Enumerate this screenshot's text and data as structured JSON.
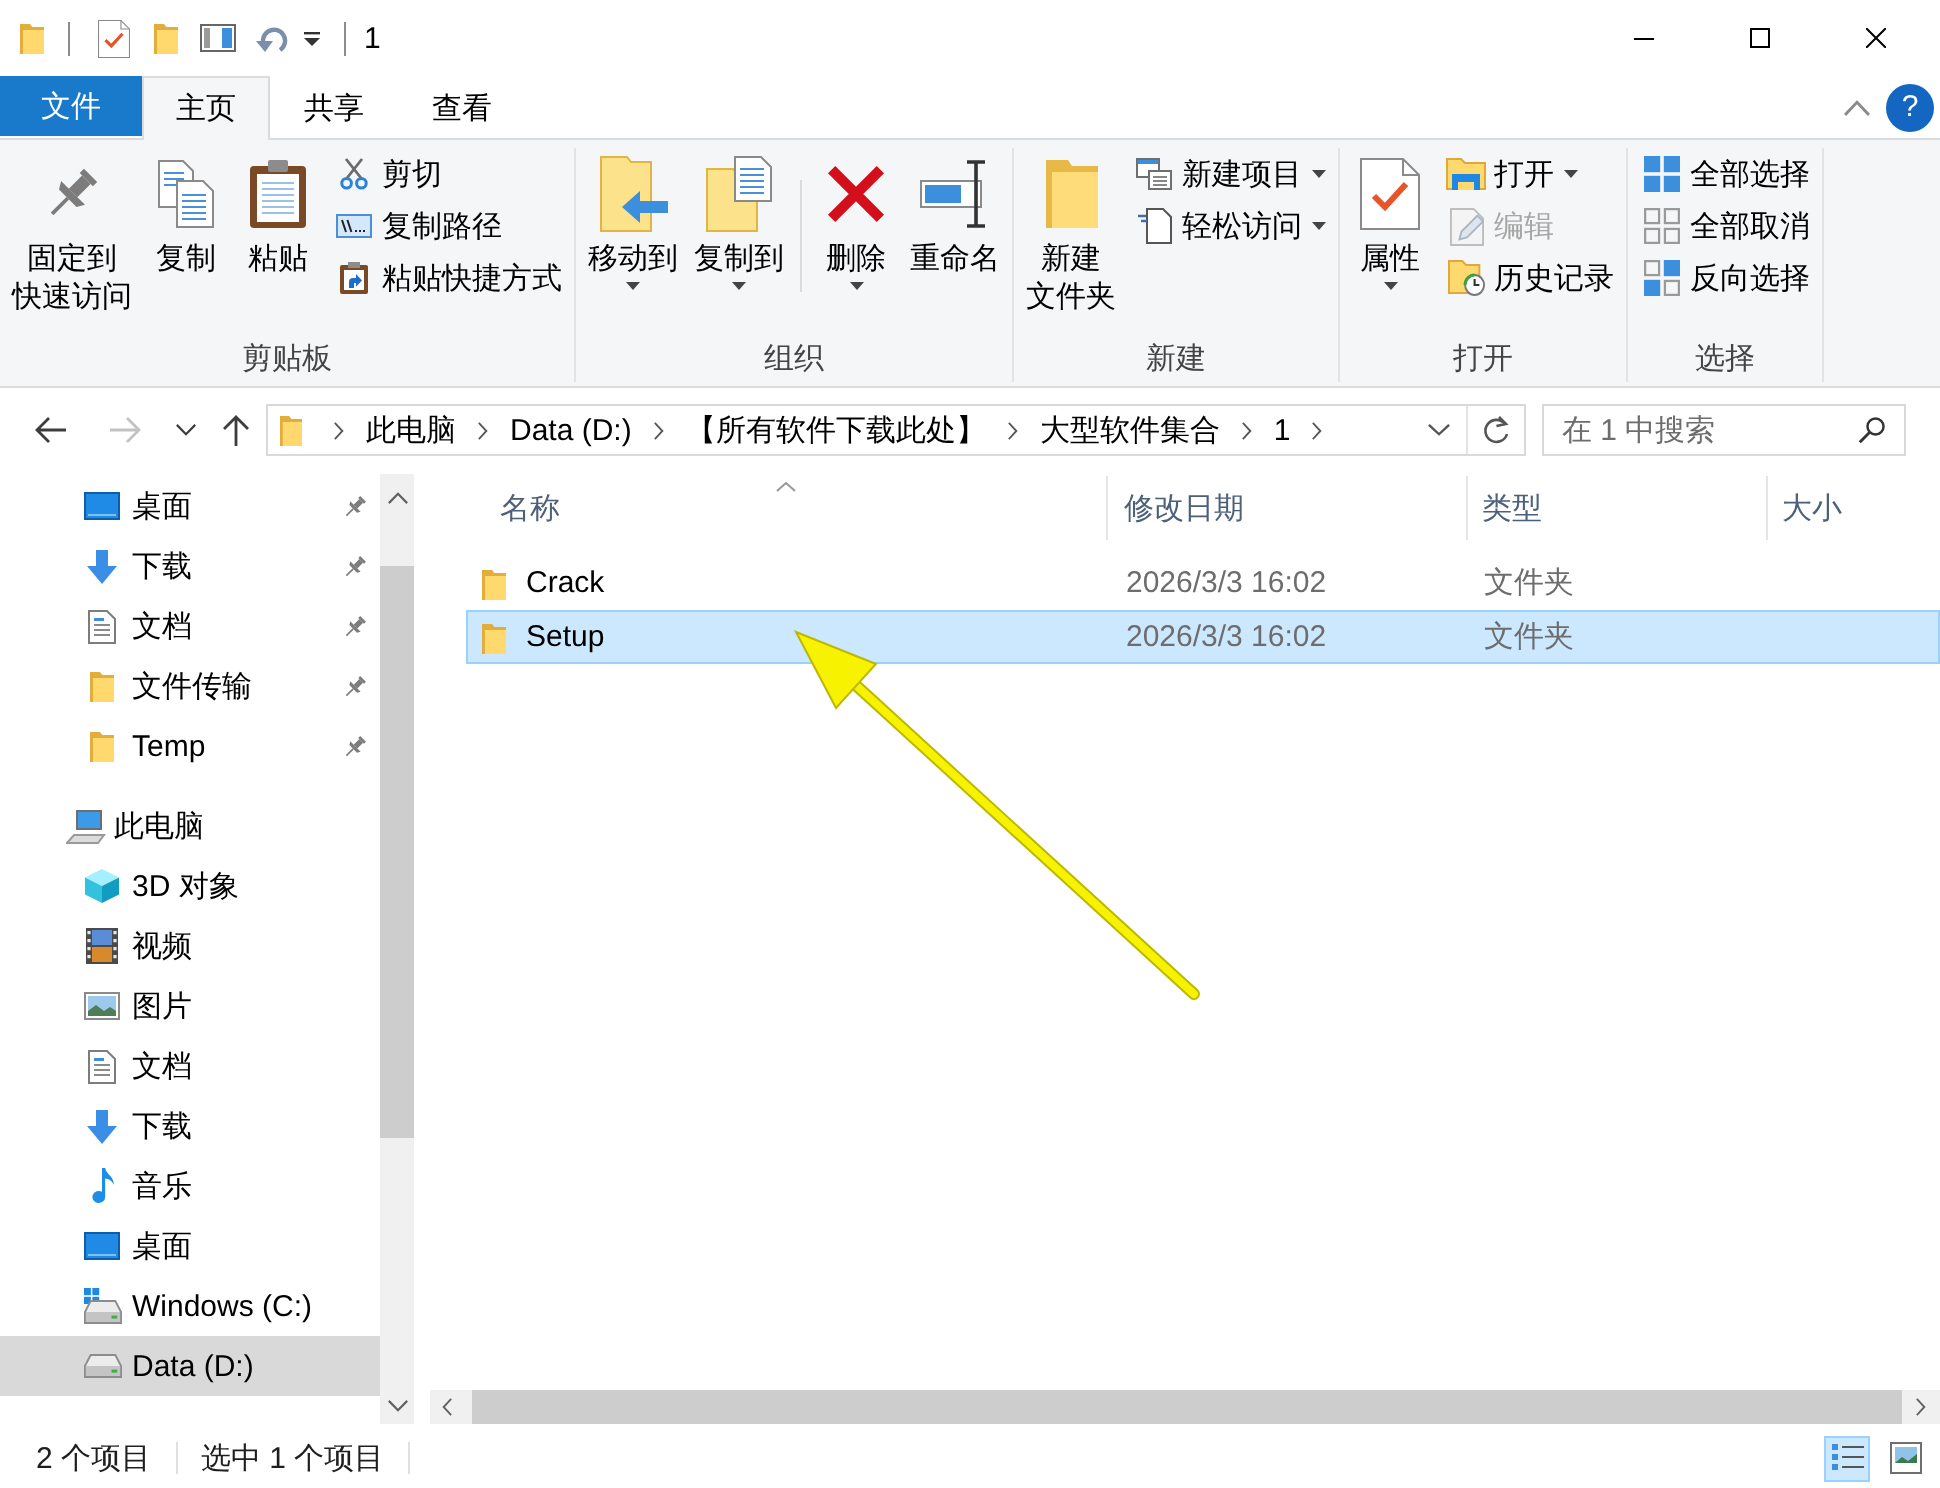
{
  "window": {
    "title": "1",
    "help_button": "?"
  },
  "tabs": [
    {
      "label": "文件",
      "kind": "file",
      "selected": false
    },
    {
      "label": "主页",
      "kind": "tab",
      "selected": true
    },
    {
      "label": "共享",
      "kind": "tab",
      "selected": false
    },
    {
      "label": "查看",
      "kind": "tab",
      "selected": false
    }
  ],
  "ribbon": {
    "groups": [
      {
        "label": "剪贴板",
        "columns": [
          {
            "kind": "large",
            "lines": [
              "固定到",
              "快速访问"
            ],
            "dropdown": false,
            "disabled": false
          },
          {
            "kind": "large",
            "lines": [
              "复制"
            ],
            "dropdown": false,
            "disabled": false
          },
          {
            "kind": "large",
            "lines": [
              "粘贴"
            ],
            "dropdown": false,
            "disabled": false
          },
          {
            "kind": "stack",
            "items": [
              {
                "label": "剪切",
                "dropdown": false,
                "disabled": false
              },
              {
                "label": "复制路径",
                "dropdown": false,
                "disabled": false
              },
              {
                "label": "粘贴快捷方式",
                "dropdown": false,
                "disabled": false
              }
            ]
          }
        ]
      },
      {
        "label": "组织",
        "columns": [
          {
            "kind": "large",
            "lines": [
              "移动到"
            ],
            "dropdown": true,
            "disabled": false
          },
          {
            "kind": "large",
            "lines": [
              "复制到"
            ],
            "dropdown": true,
            "disabled": false
          },
          {
            "kind": "separator"
          },
          {
            "kind": "large",
            "lines": [
              "删除"
            ],
            "dropdown": true,
            "disabled": false
          },
          {
            "kind": "large",
            "lines": [
              "重命名"
            ],
            "dropdown": false,
            "disabled": false
          }
        ]
      },
      {
        "label": "新建",
        "columns": [
          {
            "kind": "large",
            "lines": [
              "新建",
              "文件夹"
            ],
            "dropdown": false,
            "disabled": false
          },
          {
            "kind": "stack",
            "items": [
              {
                "label": "新建项目",
                "dropdown": true,
                "disabled": false
              },
              {
                "label": "轻松访问",
                "dropdown": true,
                "disabled": false
              }
            ]
          }
        ]
      },
      {
        "label": "打开",
        "columns": [
          {
            "kind": "large",
            "lines": [
              "属性"
            ],
            "dropdown": true,
            "disabled": false
          },
          {
            "kind": "stack",
            "items": [
              {
                "label": "打开",
                "dropdown": true,
                "disabled": false
              },
              {
                "label": "编辑",
                "dropdown": false,
                "disabled": true
              },
              {
                "label": "历史记录",
                "dropdown": false,
                "disabled": false
              }
            ]
          }
        ]
      },
      {
        "label": "选择",
        "columns": [
          {
            "kind": "stack",
            "items": [
              {
                "label": "全部选择",
                "dropdown": false,
                "disabled": false
              },
              {
                "label": "全部取消",
                "dropdown": false,
                "disabled": false
              },
              {
                "label": "反向选择",
                "dropdown": false,
                "disabled": false
              }
            ]
          }
        ]
      }
    ]
  },
  "navigation_buttons": [
    {
      "kind": "back",
      "disabled": false
    },
    {
      "kind": "forward",
      "disabled": true
    },
    {
      "kind": "recent",
      "disabled": false
    },
    {
      "kind": "up",
      "disabled": false
    }
  ],
  "address": {
    "breadcrumbs": [
      "此电脑",
      "Data (D:)",
      "【所有软件下载此处】",
      "大型软件集合",
      "1"
    ]
  },
  "search": {
    "placeholder": "在 1 中搜索"
  },
  "navigation_pane": {
    "quick_access": [
      {
        "label": "桌面",
        "pinned": true,
        "selected": false
      },
      {
        "label": "下载",
        "pinned": true,
        "selected": false
      },
      {
        "label": "文档",
        "pinned": true,
        "selected": false
      },
      {
        "label": "文件传输",
        "pinned": true,
        "selected": false
      },
      {
        "label": "Temp",
        "pinned": true,
        "selected": false
      }
    ],
    "tree": [
      {
        "label": "此电脑",
        "selected": false,
        "children": [
          {
            "label": "3D 对象",
            "selected": false
          },
          {
            "label": "视频",
            "selected": false
          },
          {
            "label": "图片",
            "selected": false
          },
          {
            "label": "文档",
            "selected": false
          },
          {
            "label": "下载",
            "selected": false
          },
          {
            "label": "音乐",
            "selected": false
          },
          {
            "label": "桌面",
            "selected": false
          },
          {
            "label": "Windows (C:)",
            "selected": false
          },
          {
            "label": "Data (D:)",
            "selected": true
          }
        ]
      }
    ]
  },
  "file_list": {
    "columns": [
      {
        "label": "名称",
        "sorted": true
      },
      {
        "label": "修改日期",
        "sorted": false
      },
      {
        "label": "类型",
        "sorted": false
      },
      {
        "label": "大小",
        "sorted": false
      }
    ],
    "rows": [
      {
        "name": "Crack",
        "modified": "2026/3/3 16:02",
        "type": "文件夹",
        "selected": false
      },
      {
        "name": "Setup",
        "modified": "2026/3/3 16:02",
        "type": "文件夹",
        "selected": true
      }
    ]
  },
  "status_bar": {
    "item_count": "2 个项目",
    "selection_info": "选中 1 个项目",
    "views": [
      {
        "kind": "details",
        "selected": true
      },
      {
        "kind": "large_icons",
        "selected": false
      }
    ]
  }
}
